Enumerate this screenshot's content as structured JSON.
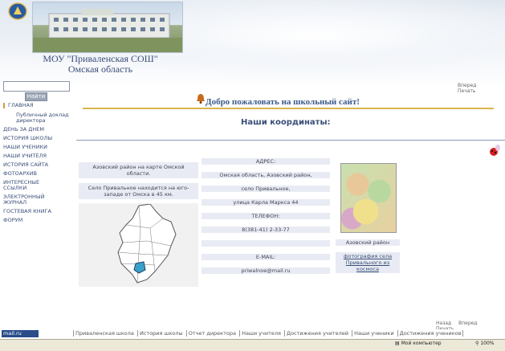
{
  "header": {
    "school_name_line1": "МОУ \"Приваленская СОШ\"",
    "school_name_line2": "Омская область"
  },
  "search": {
    "placeholder": "",
    "button_label": "Найти"
  },
  "top_links": [
    "Вперед",
    "Печать"
  ],
  "welcome_text": "Добро пожаловать на школьный сайт!",
  "page_title": "Наши координаты:",
  "nav": {
    "items": [
      {
        "label": "ГЛАВНАЯ",
        "active": true
      },
      {
        "label": "Публичный доклад директора",
        "sub": true
      },
      {
        "label": "ДЕНЬ ЗА ДНЕМ"
      },
      {
        "label": "ИСТОРИЯ ШКОЛЫ"
      },
      {
        "label": "НАШИ УЧЕНИКИ"
      },
      {
        "label": "НАШИ УЧИТЕЛЯ"
      },
      {
        "label": "ИСТОРИЯ САЙТА"
      },
      {
        "label": "ФОТОАРХИВ"
      },
      {
        "label": "ИНТЕРЕСНЫЕ ССЫЛКИ"
      },
      {
        "label": "ЭЛЕКТРОННЫЙ ЖУРНАЛ"
      },
      {
        "label": "ГОСТЕВАЯ КНИГА"
      },
      {
        "label": "ФОРУМ"
      }
    ]
  },
  "left_column": {
    "map_caption": "Азовский район на карте Омской области.",
    "village_text": "Село Привальное находится на юго-западе от Омска в 45  км."
  },
  "contacts": {
    "address_label": "АДРЕС:",
    "address_line1": "Омская область, Азовский район,",
    "address_line2": "село Привальное,",
    "address_line3": "улица Карла Маркса 44",
    "phone_label": "ТЕЛЕФОН:",
    "phone": "8(381-41) 2-33-77",
    "email_label": "E-MAIL:",
    "email": "priwalnoe@mail.ru"
  },
  "right_column": {
    "district_caption": "Азовский район",
    "photo_link": "фотография села Привального из космоса"
  },
  "bottom_links": [
    "Назад",
    "Вперед",
    "Печать"
  ],
  "footer": {
    "logo_text": "mail.ru",
    "links": [
      "Приваленская школа",
      "История школы",
      "Отчет директора",
      "Наши учителя",
      "Достижения учителей",
      "Наши ученики",
      "Достижения учеников"
    ]
  },
  "statusbar": {
    "zone": "Мой компьютер",
    "zoom": "100%"
  },
  "colors": {
    "accent": "#d8b64c",
    "title_blue": "#3a4e78",
    "nav_marker": "#d49b3a"
  }
}
